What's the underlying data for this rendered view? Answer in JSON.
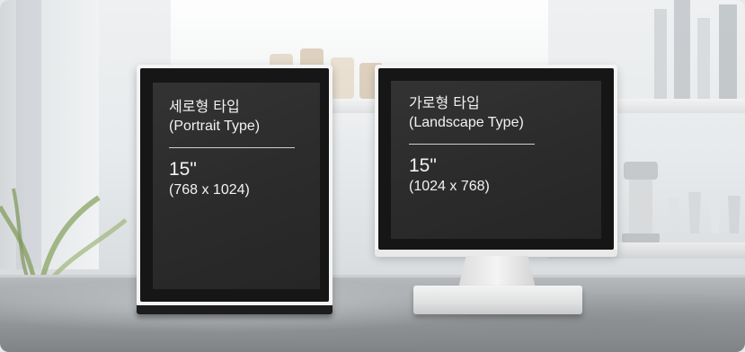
{
  "devices": [
    {
      "type_korean": "세로형 타입",
      "type_english": "(Portrait Type)",
      "size": "15\"",
      "resolution": "(768 x 1024)"
    },
    {
      "type_korean": "가로형 타입",
      "type_english": "(Landscape Type)",
      "size": "15\"",
      "resolution": "(1024 x 768)"
    }
  ],
  "colors": {
    "screen": "#2b2b2b",
    "text": "#f2f2f2",
    "device_body": "#f4f4f4"
  }
}
